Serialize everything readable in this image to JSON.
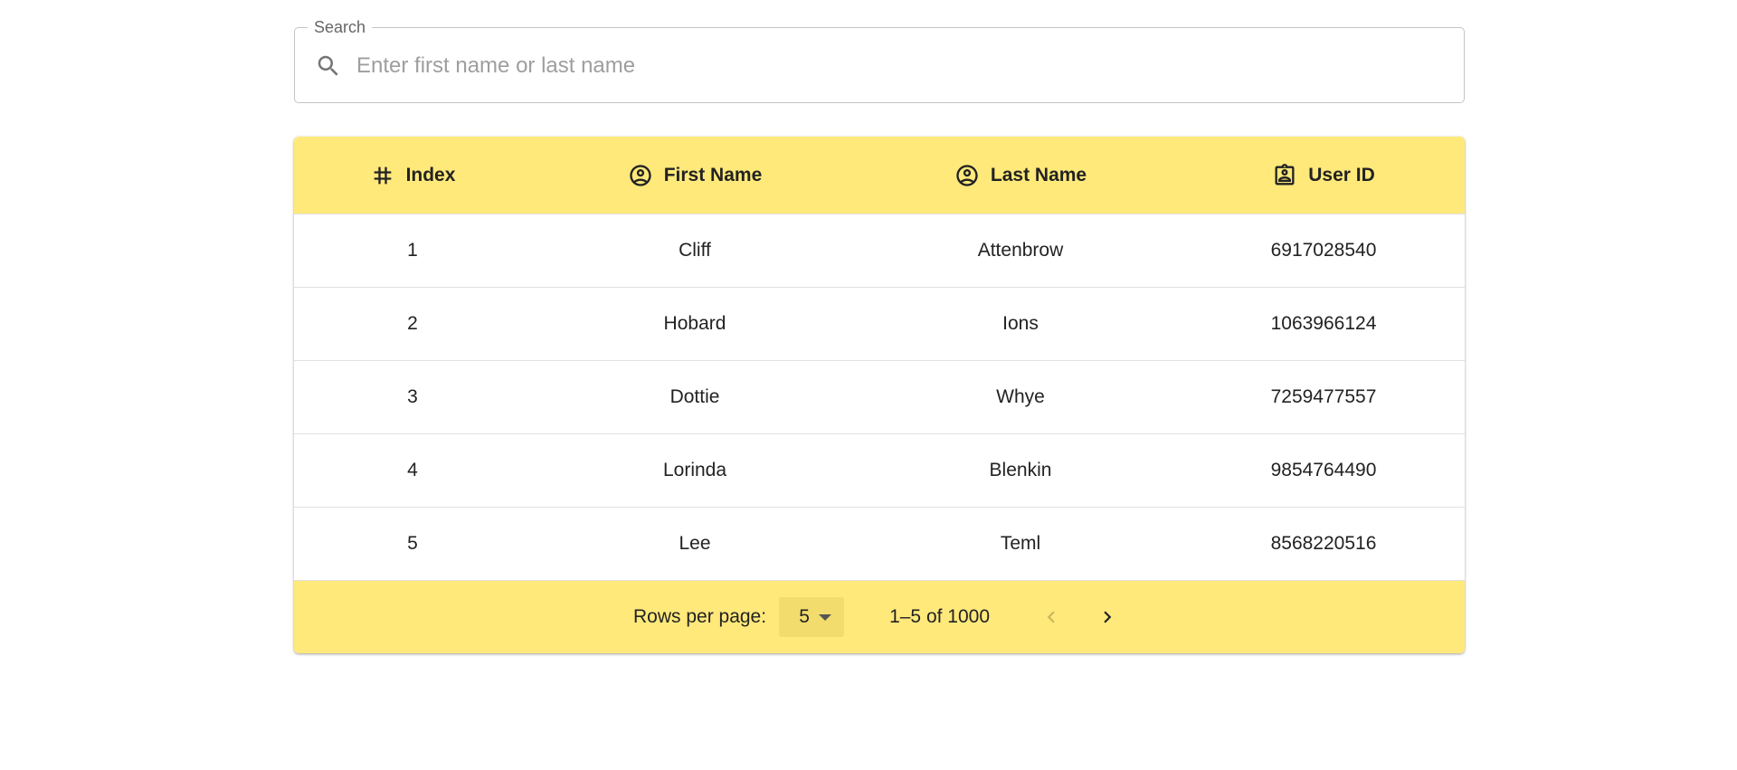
{
  "search": {
    "label": "Search",
    "placeholder": "Enter first name or last name",
    "value": ""
  },
  "table": {
    "columns": [
      {
        "label": "Index",
        "icon": "hash-icon"
      },
      {
        "label": "First Name",
        "icon": "account-circle-icon"
      },
      {
        "label": "Last Name",
        "icon": "account-circle-icon"
      },
      {
        "label": "User ID",
        "icon": "id-badge-icon"
      }
    ],
    "rows": [
      {
        "index": "1",
        "first_name": "Cliff",
        "last_name": "Attenbrow",
        "user_id": "6917028540"
      },
      {
        "index": "2",
        "first_name": "Hobard",
        "last_name": "Ions",
        "user_id": "1063966124"
      },
      {
        "index": "3",
        "first_name": "Dottie",
        "last_name": "Whye",
        "user_id": "7259477557"
      },
      {
        "index": "4",
        "first_name": "Lorinda",
        "last_name": "Blenkin",
        "user_id": "9854764490"
      },
      {
        "index": "5",
        "first_name": "Lee",
        "last_name": "Teml",
        "user_id": "8568220516"
      }
    ]
  },
  "pagination": {
    "rows_per_page_label": "Rows per page:",
    "rows_per_page_value": "5",
    "range_label": "1–5 of 1000",
    "prev_icon": "chevron-left-icon",
    "next_icon": "chevron-right-icon"
  },
  "colors": {
    "header_bg": "#ffe97b",
    "select_bg": "#f2dc6d"
  }
}
